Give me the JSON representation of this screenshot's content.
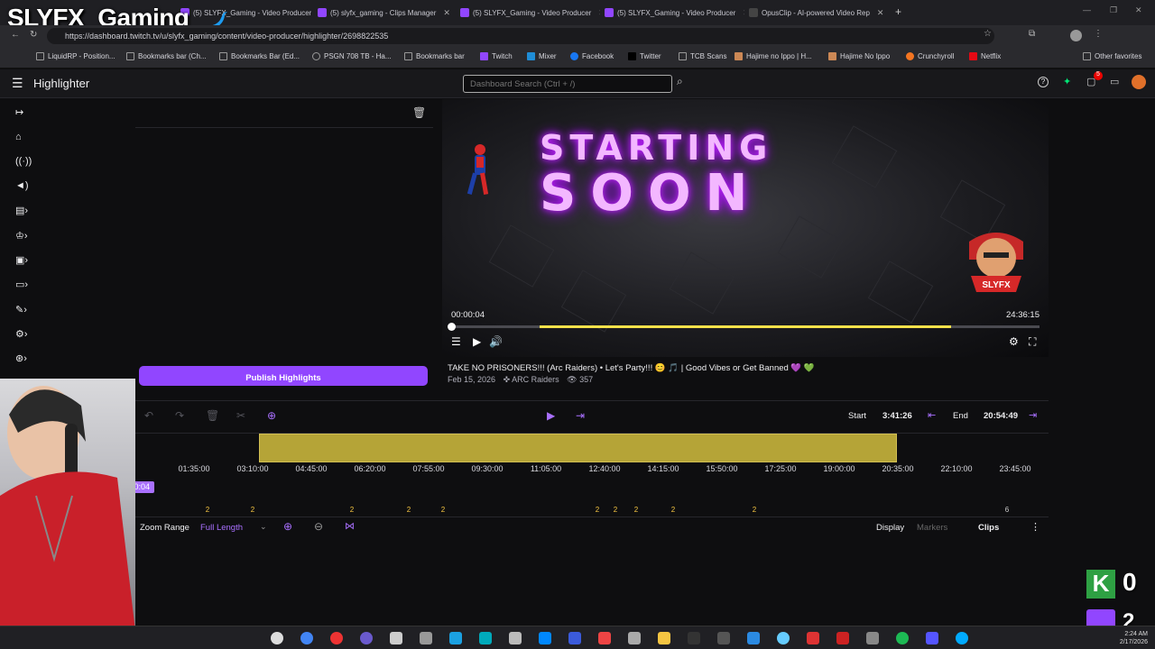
{
  "overlay": {
    "channel_title": "SLYFX_Gaming"
  },
  "browser": {
    "tabs": [
      {
        "label": "(5) SLYFX_Gaming - Video Producer"
      },
      {
        "label": "(5) slyfx_gaming - Clips Manager"
      },
      {
        "label": "(5) SLYFX_Gaming - Video Producer"
      },
      {
        "label": "(5) SLYFX_Gaming - Video Producer"
      },
      {
        "label": "OpusClip - AI-powered Video Rep"
      }
    ],
    "url": "https://dashboard.twitch.tv/u/slyfx_gaming/content/video-producer/highlighter/2698822535",
    "bookmarks": [
      "LiquidRP - Position...",
      "Bookmarks bar (Ch...",
      "Bookmarks Bar (Ed...",
      "PSGN 708 TB - Ha...",
      "Bookmarks bar",
      "Twitch",
      "Mixer",
      "Facebook",
      "Twitter",
      "TCB Scans",
      "Hajime no Ippo | H...",
      "Hajime No Ippo",
      "Crunchyroll",
      "Netflix"
    ],
    "other_favorites": "Other favorites"
  },
  "header": {
    "title": "Highlighter",
    "search_placeholder": "Dashboard Search (Ctrl + /)",
    "notification_count": "5"
  },
  "left_panel": {
    "publish_label": "Publish Highlights"
  },
  "player": {
    "starting_line1": "STARTING",
    "starting_line2": "SOON",
    "current_time": "00:00:04",
    "duration": "24:36:15",
    "progress_fraction": 0.0,
    "highlight_start_fraction": 0.15,
    "highlight_end_fraction": 0.85
  },
  "video": {
    "title": "TAKE NO PRISONERS!!! (Arc Raiders) • Let's Party!!! 😊 🎵 | Good Vibes or Get Banned 💜 💚",
    "date": "Feb 15, 2026",
    "game": "ARC Raiders",
    "views": "357"
  },
  "editor": {
    "start_label": "Start",
    "start_value": "3:41:26",
    "end_label": "End",
    "end_value": "20:54:49",
    "playhead_time": "00:00:04",
    "ticks": [
      "01:35:00",
      "03:10:00",
      "04:45:00",
      "06:20:00",
      "07:55:00",
      "09:30:00",
      "11:05:00",
      "12:40:00",
      "14:15:00",
      "15:50:00",
      "17:25:00",
      "19:00:00",
      "20:35:00",
      "22:10:00",
      "23:45:00"
    ],
    "marker_counts": [
      "2",
      "2",
      "2",
      "2",
      "2",
      "2",
      "2",
      "2",
      "2",
      "2",
      "6"
    ],
    "zoom_range_label": "Zoom Range",
    "zoom_value": "Full Length",
    "display_label": "Display",
    "markers_label": "Markers",
    "clips_label": "Clips"
  },
  "stream_overlay": {
    "k_label": "K",
    "k_count": "0",
    "second_count": "2"
  },
  "taskbar": {
    "time": "2:24 AM",
    "date": "2/17/2026"
  },
  "colors": {
    "accent": "#9146ff",
    "highlight": "#c8b53c",
    "marker": "#f5c542"
  }
}
